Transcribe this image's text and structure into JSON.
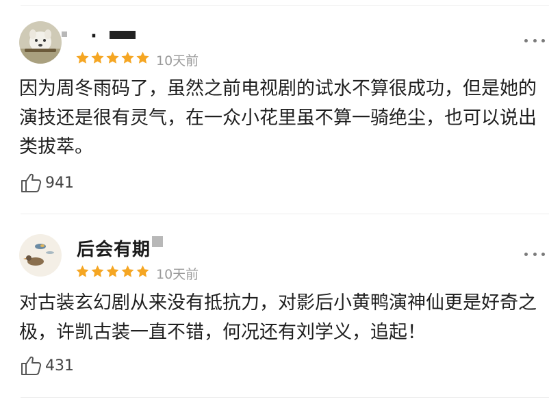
{
  "comments": [
    {
      "username": "·",
      "rating": 5,
      "time": "10天前",
      "content": "因为周冬雨码了，虽然之前电视剧的试水不算很成功，但是她的演技还是很有灵气，在一众小花里虽不算一骑绝尘，也可以说出类拔萃。",
      "likes": "941"
    },
    {
      "username": "后会有期",
      "rating": 5,
      "time": "10天前",
      "content": "对古装玄幻剧从来没有抵抗力，对影后小黄鸭演神仙更是好奇之极，许凯古装一直不错，何况还有刘学义，追起！",
      "likes": "431"
    }
  ],
  "colors": {
    "star": "#f5a623",
    "time": "#9a9a9a",
    "text": "#1f1f1f"
  },
  "icons": {
    "more": "more-icon",
    "like": "thumbs-up-icon",
    "star": "star-icon"
  }
}
